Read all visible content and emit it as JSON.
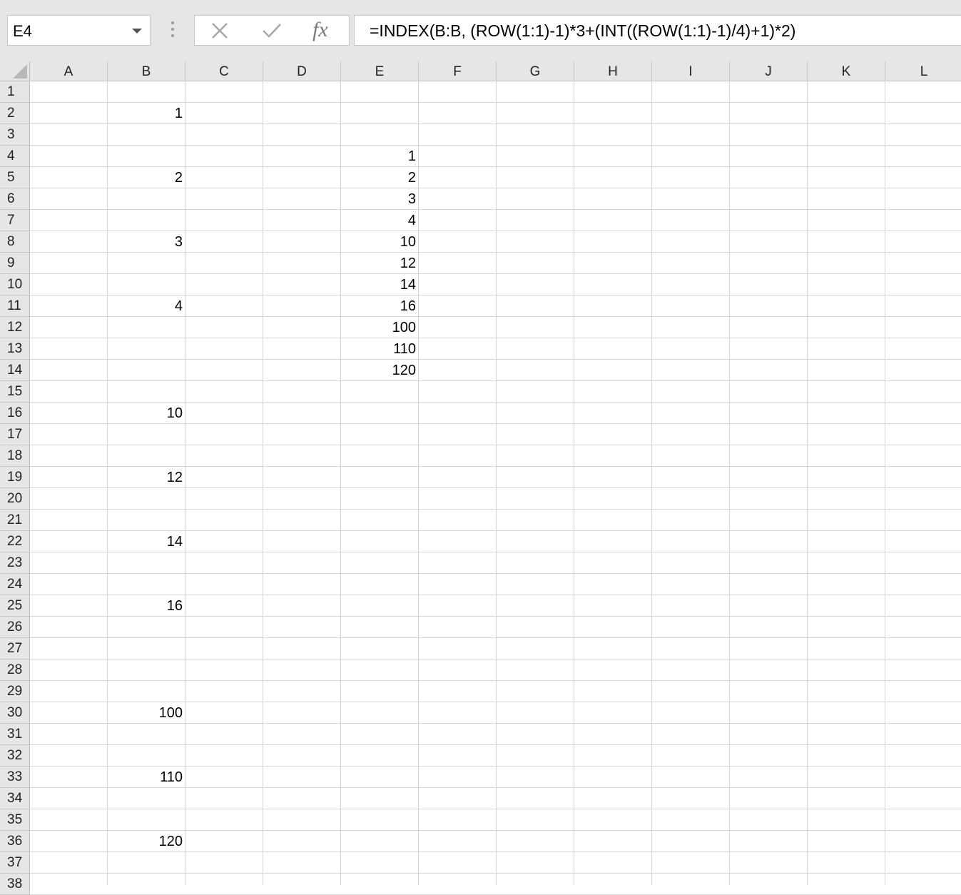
{
  "name_box": {
    "value": "E4"
  },
  "formula_bar": {
    "cancel_icon": "x-icon",
    "enter_icon": "check-icon",
    "fx_label": "fx",
    "formula": "=INDEX(B:B, (ROW(1:1)-1)*3+(INT((ROW(1:1)-1)/4)+1)*2)"
  },
  "sheet": {
    "columns": [
      "A",
      "B",
      "C",
      "D",
      "E",
      "F",
      "G",
      "H",
      "I",
      "J",
      "K",
      "L"
    ],
    "rows": [
      "1",
      "2",
      "3",
      "4",
      "5",
      "6",
      "7",
      "8",
      "9",
      "10",
      "11",
      "12",
      "13",
      "14",
      "15",
      "16",
      "17",
      "18",
      "19",
      "20",
      "21",
      "22",
      "23",
      "24",
      "25",
      "26",
      "27",
      "28",
      "29",
      "30",
      "31",
      "32",
      "33",
      "34",
      "35",
      "36",
      "37",
      "38"
    ],
    "cells": [
      {
        "ref": "B2",
        "value": "1"
      },
      {
        "ref": "B5",
        "value": "2"
      },
      {
        "ref": "B8",
        "value": "3"
      },
      {
        "ref": "B11",
        "value": "4"
      },
      {
        "ref": "B16",
        "value": "10"
      },
      {
        "ref": "B19",
        "value": "12"
      },
      {
        "ref": "B22",
        "value": "14"
      },
      {
        "ref": "B25",
        "value": "16"
      },
      {
        "ref": "B30",
        "value": "100"
      },
      {
        "ref": "B33",
        "value": "110"
      },
      {
        "ref": "B36",
        "value": "120"
      },
      {
        "ref": "E4",
        "value": "1"
      },
      {
        "ref": "E5",
        "value": "2"
      },
      {
        "ref": "E6",
        "value": "3"
      },
      {
        "ref": "E7",
        "value": "4"
      },
      {
        "ref": "E8",
        "value": "10"
      },
      {
        "ref": "E9",
        "value": "12"
      },
      {
        "ref": "E10",
        "value": "14"
      },
      {
        "ref": "E11",
        "value": "16"
      },
      {
        "ref": "E12",
        "value": "100"
      },
      {
        "ref": "E13",
        "value": "110"
      },
      {
        "ref": "E14",
        "value": "120"
      }
    ]
  }
}
